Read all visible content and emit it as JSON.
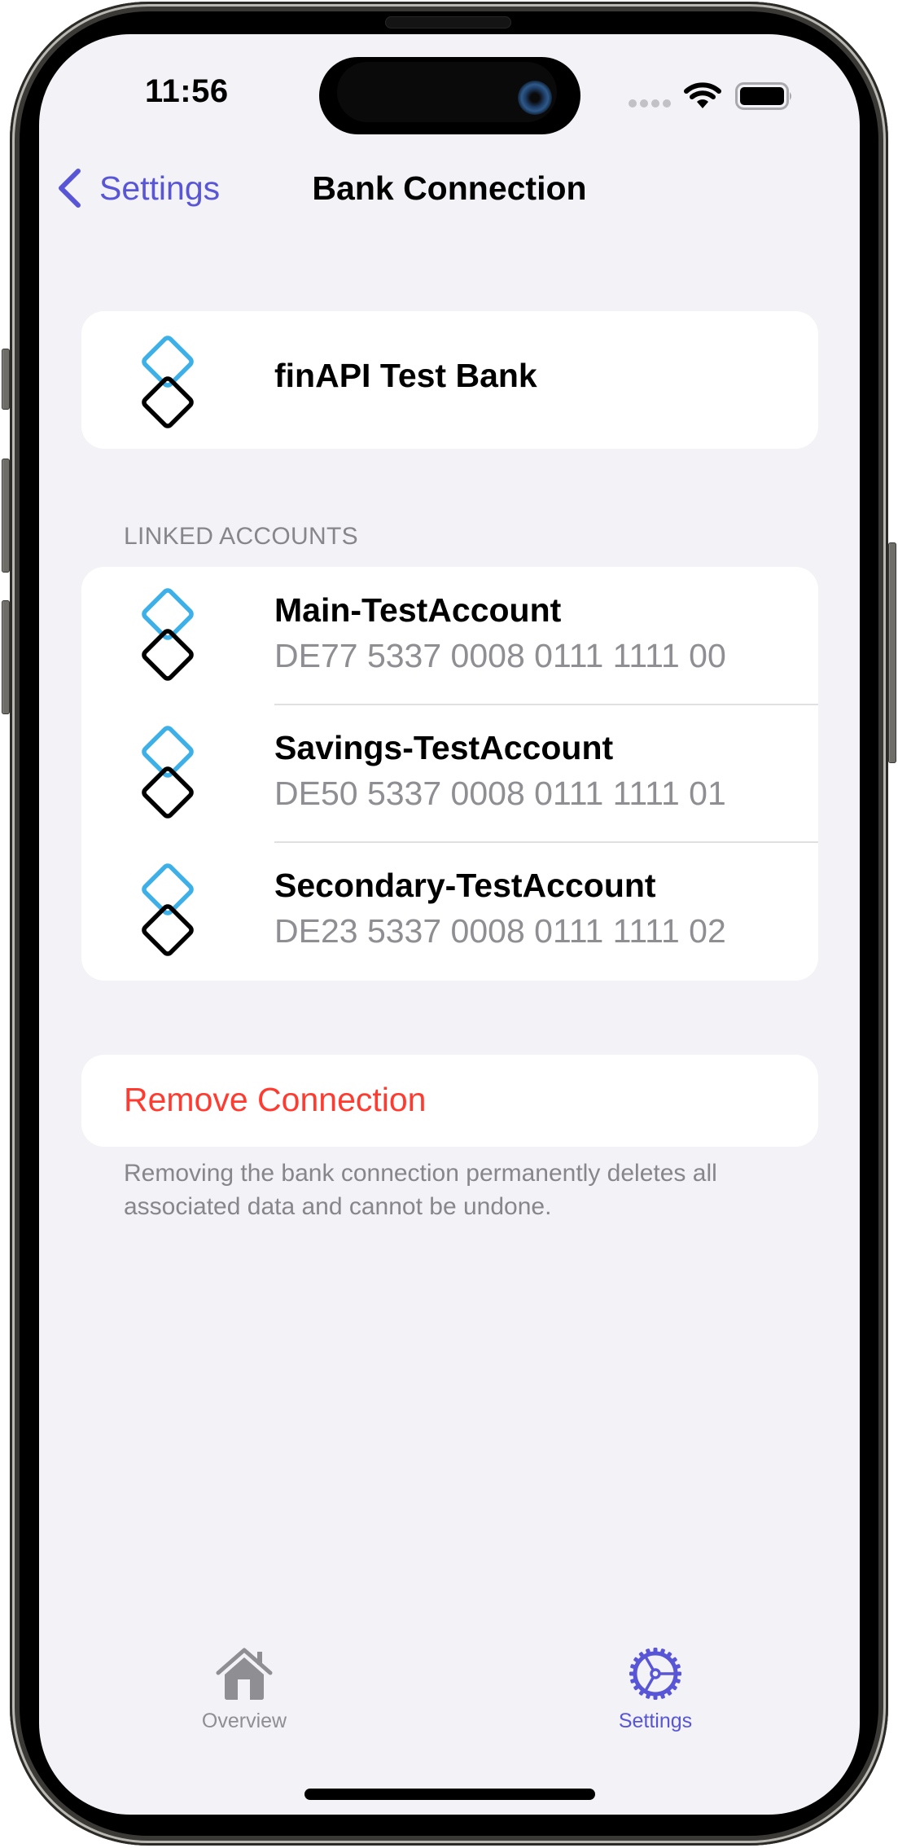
{
  "status_bar": {
    "time": "11:56",
    "signal_icon": "cellular-signal-icon",
    "wifi_icon": "wifi-icon",
    "battery_icon": "battery-icon"
  },
  "nav": {
    "back_label": "Settings",
    "back_icon": "chevron-left-icon",
    "title": "Bank Connection"
  },
  "bank": {
    "name": "finAPI Test Bank",
    "logo_icon": "finapi-logo-icon"
  },
  "linked_accounts": {
    "header": "LINKED ACCOUNTS",
    "items": [
      {
        "name": "Main-TestAccount",
        "iban": "DE77 5337 0008 0111 1111 00"
      },
      {
        "name": "Savings-TestAccount",
        "iban": "DE50 5337 0008 0111 1111 01"
      },
      {
        "name": "Secondary-TestAccount",
        "iban": "DE23 5337 0008 0111 1111 02"
      }
    ]
  },
  "remove": {
    "label": "Remove Connection",
    "note": "Removing the bank connection permanently deletes all associated data and cannot be undone."
  },
  "tab_bar": {
    "tabs": [
      {
        "label": "Overview",
        "icon": "house-icon",
        "selected": false
      },
      {
        "label": "Settings",
        "icon": "gear-icon",
        "selected": true
      }
    ]
  },
  "colors": {
    "accent": "#5856D6",
    "destructive": "#FF3B30",
    "secondary_text": "#8E8E93",
    "background": "#F2F2F7",
    "logo_blue": "#3DB0E8"
  }
}
